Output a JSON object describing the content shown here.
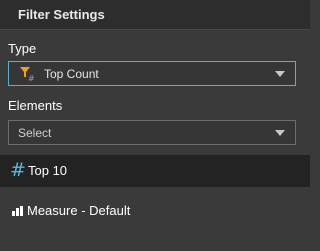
{
  "panel": {
    "title": "Filter Settings"
  },
  "type_section": {
    "label": "Type",
    "selected": "Top Count",
    "icon": "funnel-hash-icon"
  },
  "elements_section": {
    "label": "Elements",
    "placeholder": "Select"
  },
  "items": [
    {
      "label": "Top 10",
      "icon": "hash-icon"
    },
    {
      "label": "Measure - Default",
      "icon": "bar-chart-icon"
    }
  ],
  "colors": {
    "accent": "#5aaed2",
    "hash": "#59b7e3",
    "funnel": "#f0a020",
    "background": "#3a3a3a",
    "header": "#2d2d2d",
    "selected_row": "#232323"
  }
}
